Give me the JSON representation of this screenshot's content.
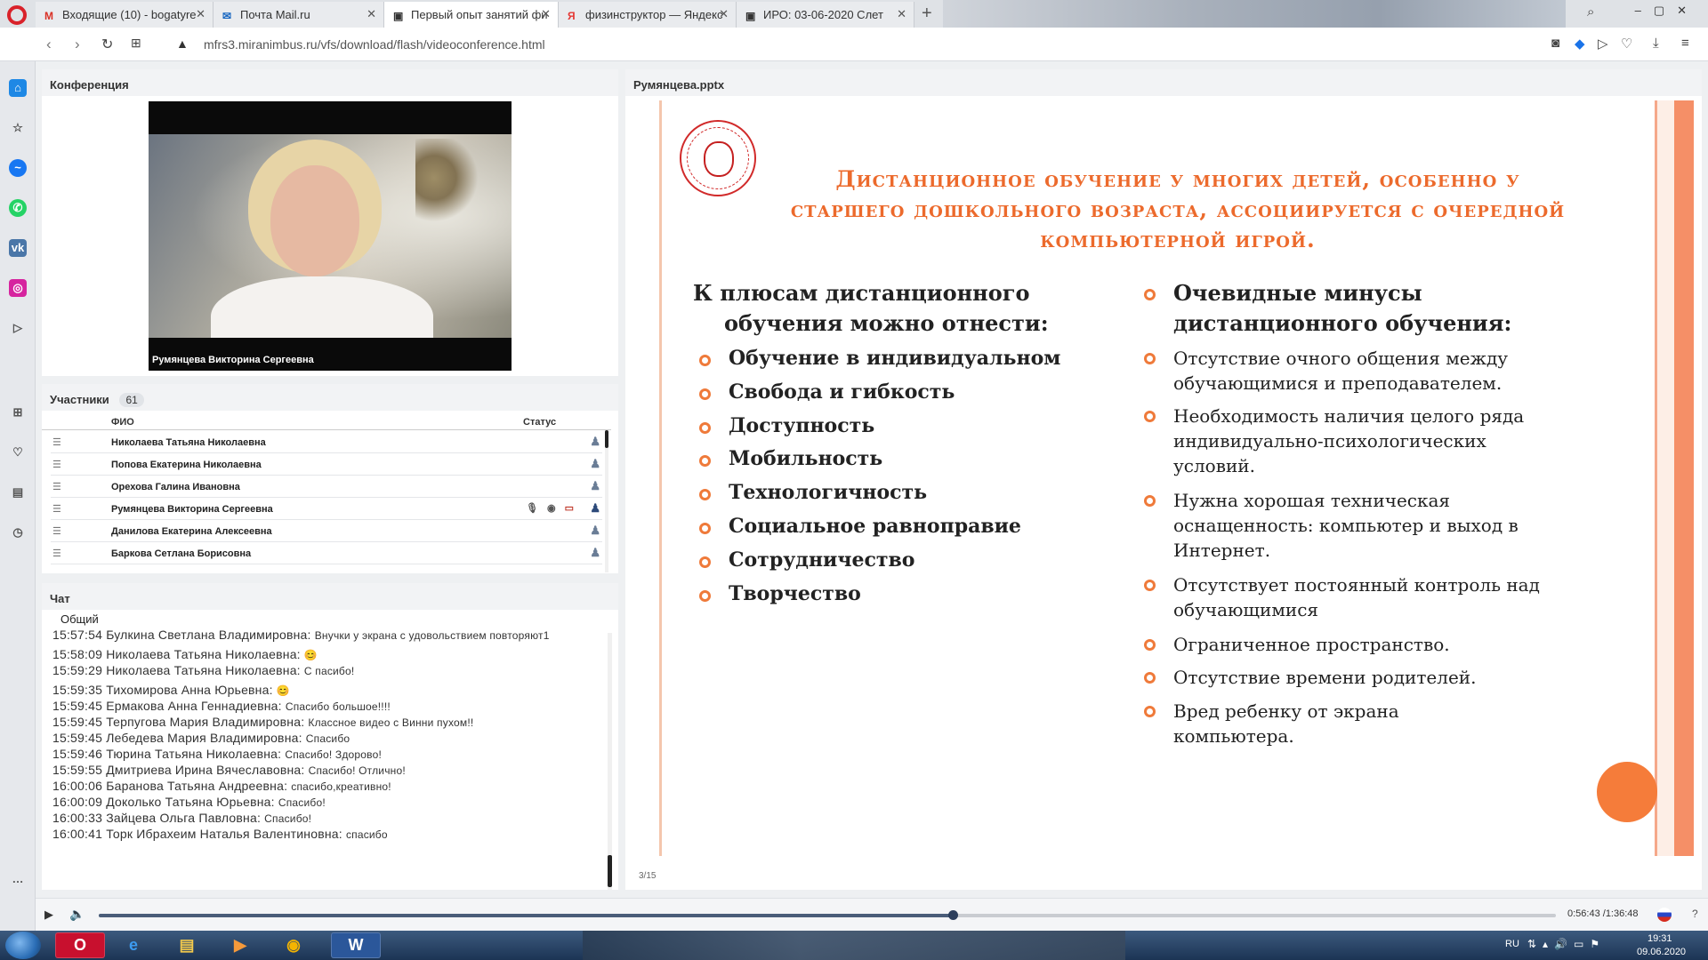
{
  "browser": {
    "tabs": [
      {
        "icon": "M",
        "label": "Входящие (10) - bogatyre",
        "color": "#d93025"
      },
      {
        "icon": "✉",
        "label": "Почта Mail.ru",
        "color": "#1565c0"
      },
      {
        "icon": "▣",
        "label": "Первый опыт занятий фи",
        "color": "#333333"
      },
      {
        "icon": "Я",
        "label": "физинструктор — Яндекс",
        "color": "#e53935"
      },
      {
        "icon": "▣",
        "label": "ИРО: 03-06-2020 Слет",
        "color": "#333333"
      }
    ],
    "url": "mfrs3.miranimbus.ru/vfs/download/flash/videoconference.html"
  },
  "conference": {
    "title": "Конференция",
    "video_caption": "Румянцева Викторина  Сергеевна"
  },
  "participants": {
    "title": "Участники",
    "count": "61",
    "col_name": "ФИО",
    "col_status": "Статус",
    "rows": [
      {
        "name": "Николаева Татьяна  Николаевна"
      },
      {
        "name": "Попова  Екатерина Николаевна"
      },
      {
        "name": "Орехова  Галина  Ивановна"
      },
      {
        "name": "Румянцева Викторина  Сергеевна"
      },
      {
        "name": "Данилова  Екатерина  Алексеевна"
      },
      {
        "name": "Баркова Сетлана Борисовна"
      }
    ]
  },
  "chat": {
    "title": "Чат",
    "tab": "Общий",
    "messages": [
      {
        "time": "15:57:54",
        "author": "Булкина  Светлана Владимировна:",
        "text": "Внучки у экрана с удовольствием повторяют1"
      },
      {
        "time": "15:58:09",
        "author": "Николаева Татьяна  Николаевна:",
        "text": "😊"
      },
      {
        "time": "15:59:29",
        "author": "Николаева Татьяна  Николаевна:",
        "text": "С пасибо!"
      },
      {
        "time": "15:59:35",
        "author": "Тихомирова Анна  Юрьевна:",
        "text": "😊"
      },
      {
        "time": "15:59:45",
        "author": "Ермакова  Анна  Геннадиевна:",
        "text": "Спасибо большое!!!!"
      },
      {
        "time": "15:59:45",
        "author": "Терпугова  Мария Владимировна:",
        "text": "Классное видео с Винни пухом!!"
      },
      {
        "time": "15:59:45",
        "author": "Лебедева Мария Владимировна:",
        "text": "Спасибо"
      },
      {
        "time": "15:59:46",
        "author": "Тюрина  Татьяна   Николаевна:",
        "text": "Спасибо! Здорово!"
      },
      {
        "time": "15:59:55",
        "author": "Дмитриева  Ирина  Вячеславовна:",
        "text": "Спасибо! Отлично!"
      },
      {
        "time": "16:00:06",
        "author": "Баранова Татьяна  Андреевна:",
        "text": "спасибо,креативно!"
      },
      {
        "time": "16:00:09",
        "author": "Доколько  Татьяна   Юрьевна:",
        "text": "Спасибо!"
      },
      {
        "time": "16:00:33",
        "author": "Зайцева Ольга Павловна:",
        "text": "Спасибо!"
      },
      {
        "time": "16:00:41",
        "author": "Торк Ибрахеим  Наталья   Валентиновна:",
        "text": "спасибо"
      }
    ]
  },
  "presentation": {
    "filename": "Румянцева.pptx",
    "page": "3/15",
    "title": "Дистанционное обучение у многих детей, особенно у старшего дошкольного возраста, ассоциируется с очередной компьютерной игрой.",
    "pros_heading": "К плюсам дистанционного обучения можно отнести:",
    "pros": [
      "Обучение в индивидуальном",
      "Свобода и гибкость",
      "Доступность",
      "Мобильность",
      "Технологичность",
      "Социальное равноправие",
      "Сотрудничество",
      "Творчество"
    ],
    "cons_heading": "Очевидные минусы дистанционного обучения:",
    "cons": [
      "Отсутствие очного общения между обучающимися и преподавателем.",
      "Необходимость наличия целого ряда индивидуально-психологических условий.",
      "Нужна хорошая техническая оснащенность: компьютер и выход в Интернет.",
      "Отсутствует постоянный контроль над обучающимися",
      "Ограниченное пространство.",
      "Отсутствие времени родителей.",
      "Вред ребенку от экрана компьютера."
    ],
    "accent_color": "#ec6a2c"
  },
  "player": {
    "time": "0:56:43 /1:36:48",
    "progress": 0.5859
  },
  "taskbar": {
    "lang": "RU",
    "clock_time": "19:31",
    "clock_date": "09.06.2020"
  }
}
